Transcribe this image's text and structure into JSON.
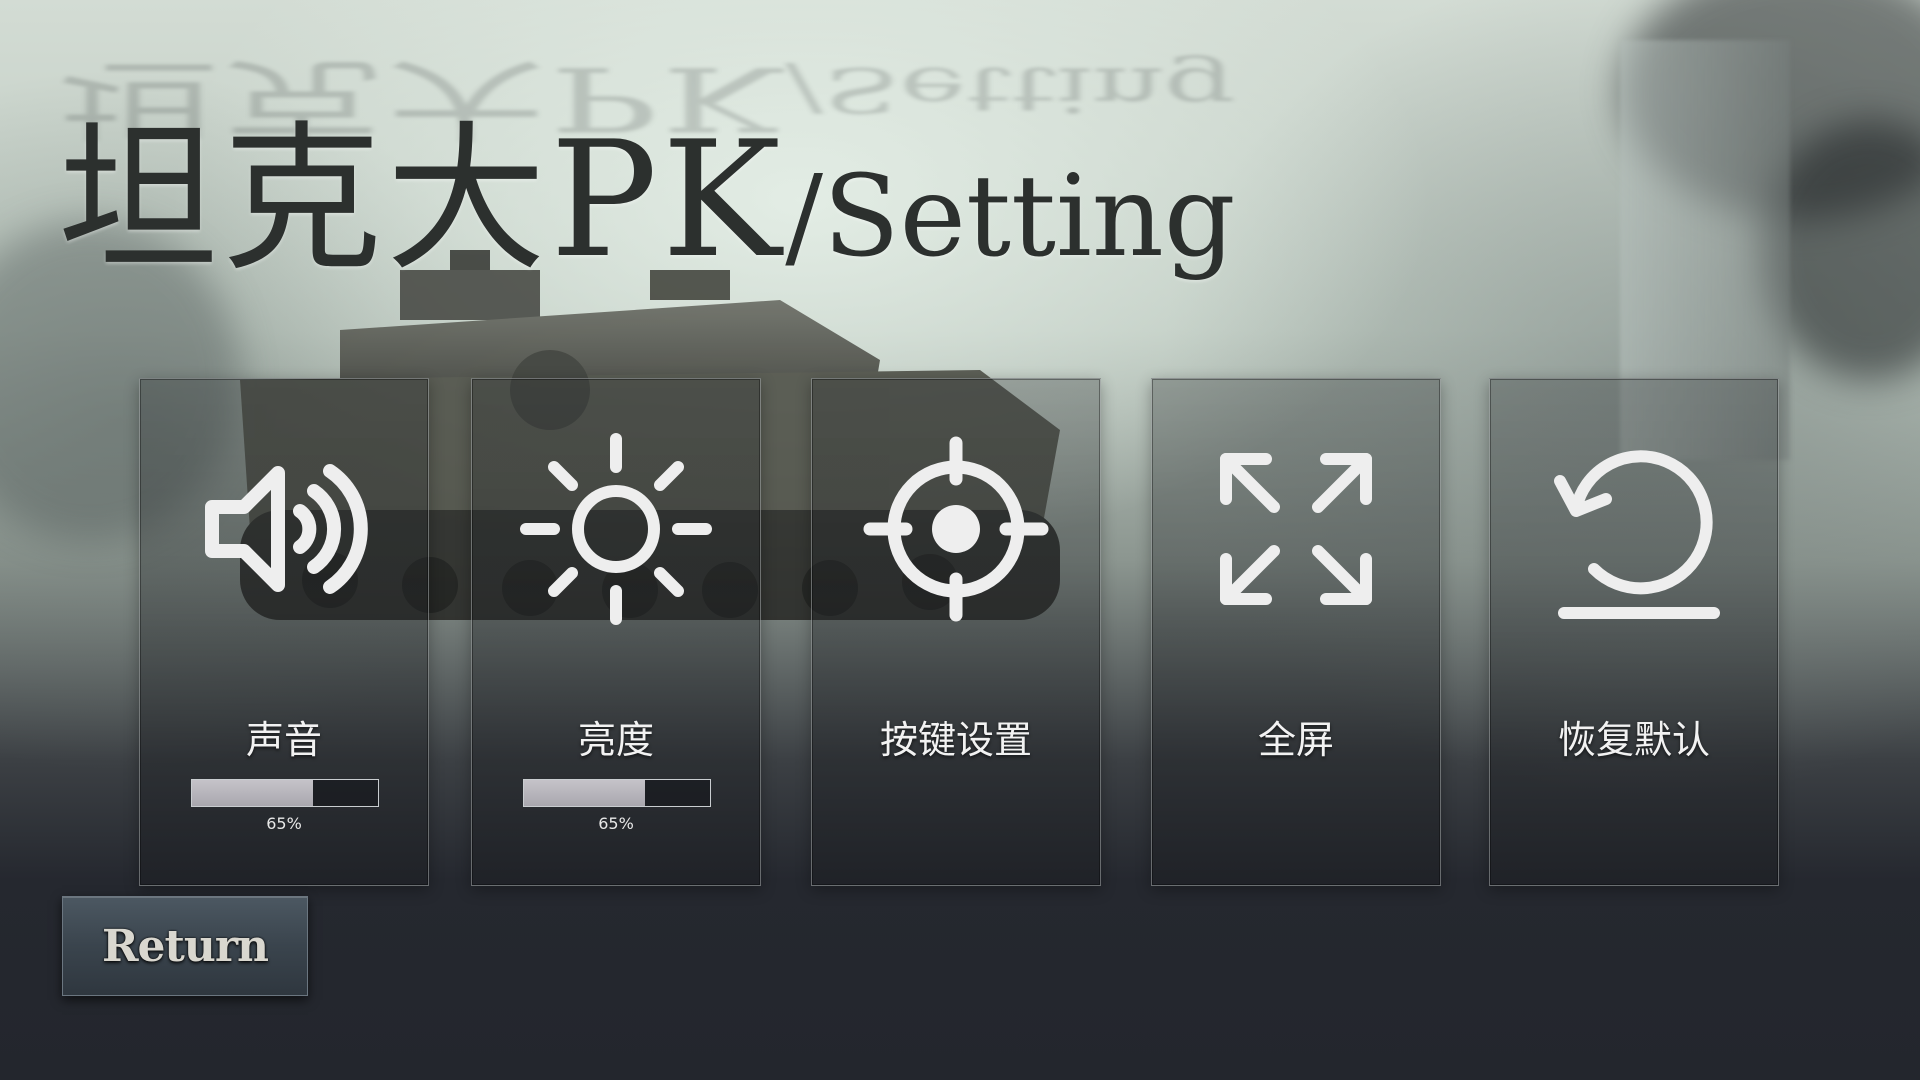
{
  "header": {
    "title_main": "坦克大PK",
    "title_sub": "/Setting"
  },
  "settings": [
    {
      "id": "sound",
      "label": "声音",
      "icon": "speaker-icon",
      "level": 0.65,
      "level_text": "65%"
    },
    {
      "id": "brightness",
      "label": "亮度",
      "icon": "sun-icon",
      "level": 0.65,
      "level_text": "65%"
    },
    {
      "id": "keybind",
      "label": "按键设置",
      "icon": "crosshair-icon"
    },
    {
      "id": "fullscreen",
      "label": "全屏",
      "icon": "expand-icon"
    },
    {
      "id": "reset",
      "label": "恢复默认",
      "icon": "reset-icon"
    }
  ],
  "footer": {
    "return_label": "Return"
  },
  "colors": {
    "icon": "#eeeeee",
    "bar_fill": "#b8b6bc",
    "card_border": "#bec4c4"
  }
}
